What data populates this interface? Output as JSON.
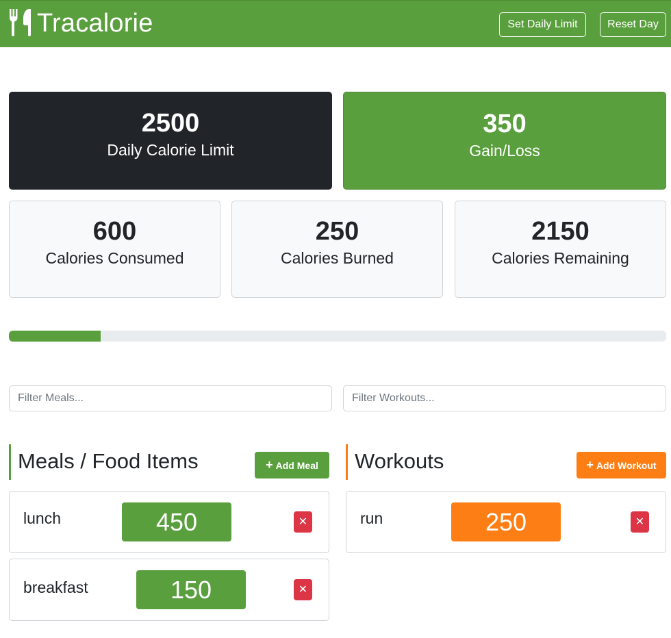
{
  "app": {
    "title": "Tracalorie",
    "icon": "utensils-icon"
  },
  "navbar": {
    "set_limit_label": "Set Daily Limit",
    "reset_label": "Reset Day"
  },
  "stats": {
    "limit": {
      "value": "2500",
      "label": "Daily Calorie Limit"
    },
    "gain_loss": {
      "value": "350",
      "label": "Gain/Loss"
    },
    "consumed": {
      "value": "600",
      "label": "Calories Consumed"
    },
    "burned": {
      "value": "250",
      "label": "Calories Burned"
    },
    "remaining": {
      "value": "2150",
      "label": "Calories Remaining"
    }
  },
  "progress": {
    "percent": 14
  },
  "filters": {
    "meals_placeholder": "Filter Meals...",
    "workouts_placeholder": "Filter Workouts..."
  },
  "meals": {
    "heading": "Meals / Food Items",
    "add_label": "Add Meal",
    "items": [
      {
        "name": "lunch",
        "calories": "450"
      },
      {
        "name": "breakfast",
        "calories": "150"
      }
    ]
  },
  "workouts": {
    "heading": "Workouts",
    "add_label": "Add Workout",
    "items": [
      {
        "name": "run",
        "calories": "250"
      }
    ]
  },
  "icons": {
    "add": "plus-icon",
    "delete": "close-icon"
  },
  "colors": {
    "primary": "#5a9f3e",
    "dark": "#212428",
    "workout": "#fd7e14",
    "danger": "#dc3545"
  }
}
